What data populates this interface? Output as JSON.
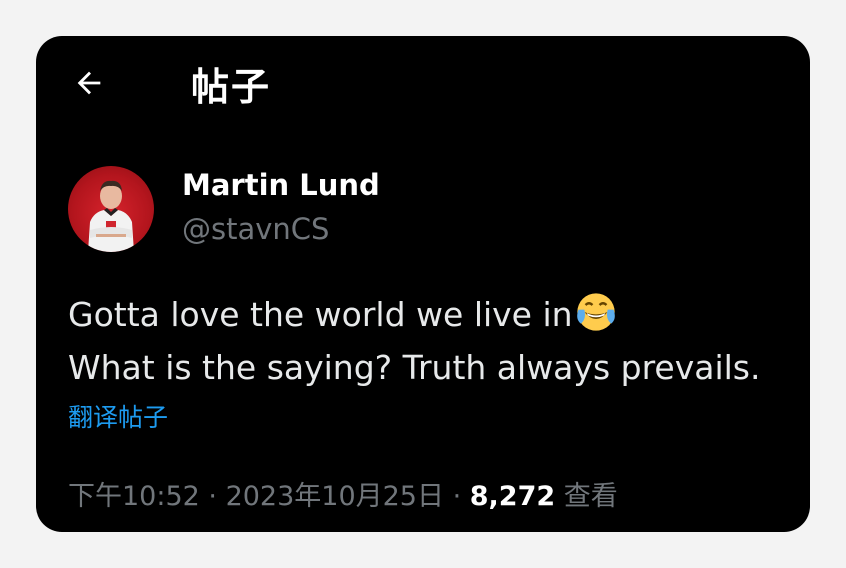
{
  "header": {
    "back_icon": "arrow-left-icon",
    "title": "帖子"
  },
  "author": {
    "name": "Martin Lund",
    "handle": "@stavnCS",
    "avatar_icon": "avatar-photo"
  },
  "tweet": {
    "lines": [
      "Gotta love the world we live in",
      "What is the saying? Truth always prevails."
    ],
    "emoji": "face-with-tears-of-joy-icon",
    "translate_label": "翻译帖子"
  },
  "meta": {
    "time": "下午10:52",
    "separator": " · ",
    "date": "2023年10月25日",
    "views_count": "8,272",
    "views_label": "查看"
  },
  "colors": {
    "background": "#000000",
    "text": "#e7e9ea",
    "muted": "#71767b",
    "link": "#1d9bf0",
    "avatar_bg": "#c41b23"
  }
}
